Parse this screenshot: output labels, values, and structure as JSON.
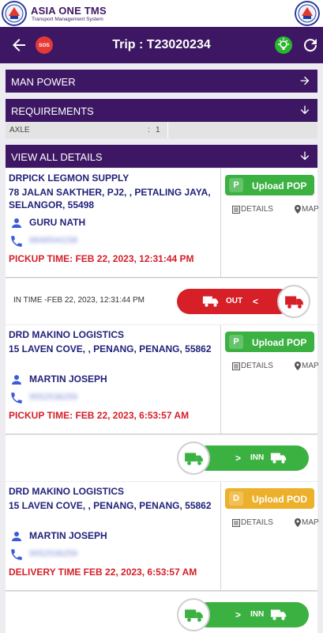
{
  "brand": {
    "title": "ASIA ONE TMS",
    "subtitle": "Transport Management System"
  },
  "toolbar": {
    "sos_label": "SOS",
    "title": "Trip : T23020234"
  },
  "sections": {
    "manpower": "MAN POWER",
    "requirements": "REQUIREMENTS",
    "view_all": "VIEW ALL DETAILS"
  },
  "requirements": {
    "key": "AXLE",
    "separator": ":",
    "value": "1"
  },
  "stops": [
    {
      "name": "DRPICK LEGMON SUPPLY",
      "address": "78 JALAN SAKTHER, PJ2, , PETALING JAYA, SELANGOR, 55498",
      "person": "GURU NATH",
      "phone": "6846544158",
      "time": "PICKUP TIME: FEB 22, 2023, 12:31:44 PM",
      "upload_badge": "P",
      "upload_label": "Upload POP",
      "details_label": "DETAILS",
      "map_label": "MAP"
    },
    {
      "name": "DRD MAKINO LOGISTICS",
      "address": "15 LAVEN COVE, , PENANG, PENANG, 55862",
      "person": "MARTIN JOSEPH",
      "phone": "9552536259",
      "time": "PICKUP TIME: FEB 22, 2023, 6:53:57 AM",
      "upload_badge": "P",
      "upload_label": "Upload POP",
      "details_label": "DETAILS",
      "map_label": "MAP"
    },
    {
      "name": "DRD MAKINO LOGISTICS",
      "address": "15 LAVEN COVE, , PENANG, PENANG, 55862",
      "person": "MARTIN JOSEPH",
      "phone": "9552536259",
      "time": "DELIVERY TIME FEB 22, 2023, 6:53:57 AM",
      "upload_badge": "D",
      "upload_label": "Upload POD",
      "details_label": "DETAILS",
      "map_label": "MAP"
    }
  ],
  "strips": [
    {
      "text": "IN TIME -FEB 22, 2023, 12:31:44 PM",
      "button": "OUT",
      "arrow": "<"
    },
    {
      "button": "INN",
      "arrow": ">"
    },
    {
      "button": "INN",
      "arrow": ">"
    }
  ],
  "colors": {
    "primary": "#3d1763",
    "green": "#3bb142",
    "red": "#d61f27",
    "gold": "#ecb02b",
    "navy_text": "#21227a"
  },
  "icons": [
    "logo-icon",
    "back-arrow-icon",
    "sos-icon",
    "bulb-icon",
    "refresh-icon",
    "arrow-right-icon",
    "arrow-down-icon",
    "person-icon",
    "phone-icon",
    "details-icon",
    "map-pin-icon",
    "truck-icon"
  ]
}
